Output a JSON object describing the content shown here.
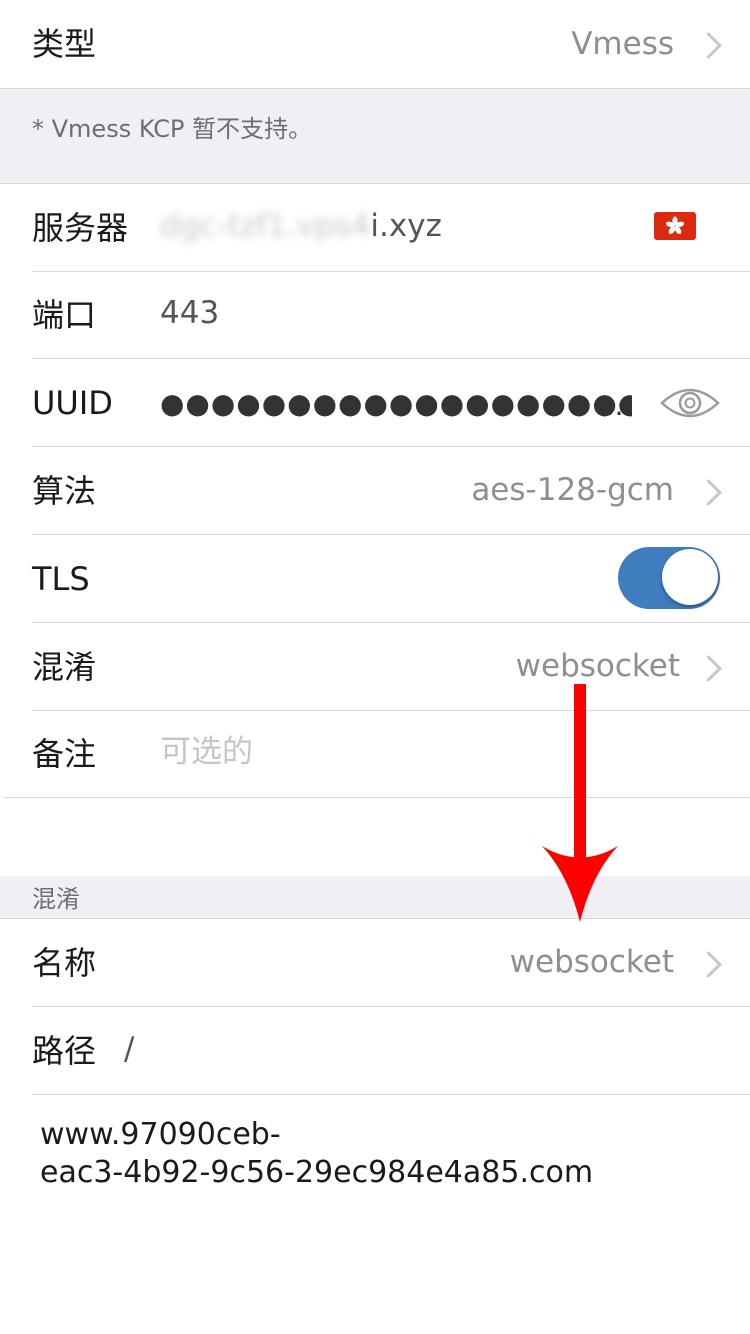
{
  "type_row": {
    "label": "类型",
    "value": "Vmess"
  },
  "notice": {
    "text": "* Vmess KCP 暂不支持。"
  },
  "server": {
    "label": "服务器",
    "value_hidden": "dgc-tzf1.vps4",
    "value_visible": "i.xyz"
  },
  "port": {
    "label": "端口",
    "value": "443"
  },
  "uuid": {
    "label": "UUID",
    "masked": "●●●●●●●●●●●●●●●●●●●●●●●●●●●●●●●●●●●●"
  },
  "cipher": {
    "label": "算法",
    "value": "aes-128-gcm"
  },
  "tls": {
    "label": "TLS",
    "enabled": true
  },
  "obfs": {
    "label": "混淆",
    "value": "websocket"
  },
  "remark": {
    "label": "备注",
    "placeholder": "可选的"
  },
  "obfs_section": {
    "header": "混淆"
  },
  "obfs_name": {
    "label": "名称",
    "value": "websocket"
  },
  "obfs_path": {
    "label": "路径",
    "value": "/"
  },
  "host": {
    "line1": "www.97090ceb-",
    "line2": "eac3-4b92-9c56-29ec984e4a85.com"
  },
  "colors": {
    "toggle": "#3f7dbf",
    "arrow": "#ff0000",
    "group_bg": "#efeff4",
    "flag": "#de2910"
  },
  "icons": {
    "eye": "eye-icon",
    "chevron": "chevron-right-icon",
    "flag": "hong-kong-flag-icon",
    "arrow": "red-down-arrow"
  }
}
